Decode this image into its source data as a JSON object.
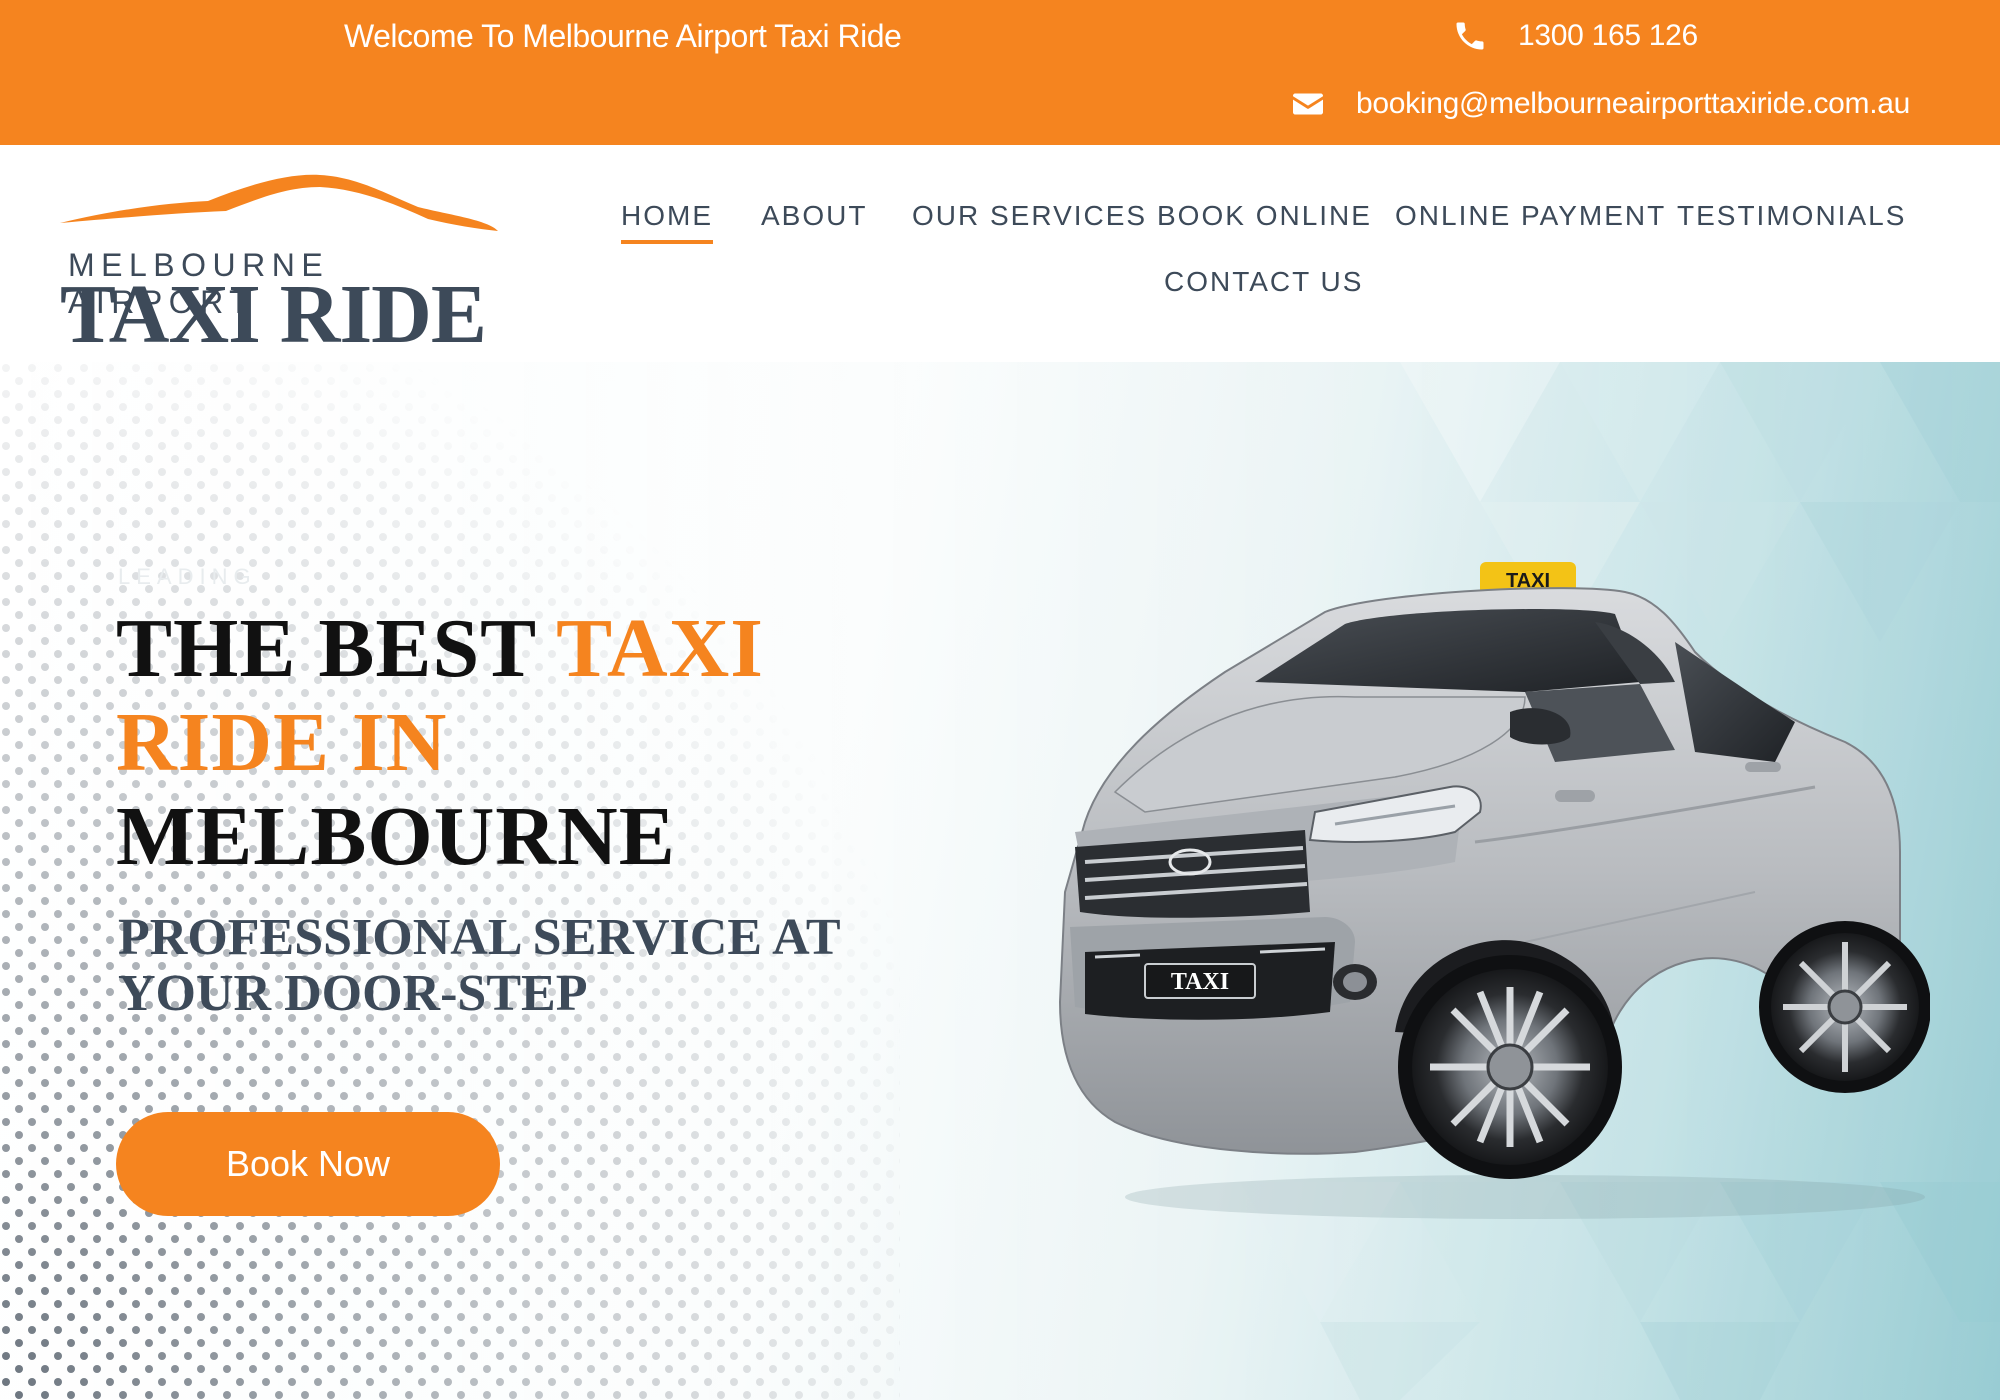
{
  "topbar": {
    "welcome": "Welcome To Melbourne Airport Taxi Ride",
    "phone": "1300 165 126",
    "email": "booking@melbourneairporttaxiride.com.au",
    "background_color": "#f5841f",
    "phone_icon": "phone-icon",
    "email_icon": "envelope-icon"
  },
  "logo": {
    "line1": "MELBOURNE AIRPORT",
    "line2": "TAXI RIDE",
    "swoosh_color": "#f5841f",
    "text_color": "#3d4a59"
  },
  "nav": {
    "items": [
      {
        "label": "HOME",
        "active": true
      },
      {
        "label": "ABOUT",
        "active": false
      },
      {
        "label": "OUR SERVICES",
        "active": false
      },
      {
        "label": "BOOK ONLINE",
        "active": false
      },
      {
        "label": "ONLINE PAYMENT",
        "active": false
      },
      {
        "label": "TESTIMONIALS",
        "active": false
      },
      {
        "label": "CONTACT US",
        "active": false
      }
    ]
  },
  "hero": {
    "eyebrow": "LEADING",
    "headline": {
      "part1": "THE BEST ",
      "accent": "TAXI RIDE IN",
      "part3": "MELBOURNE"
    },
    "subline": "PROFESSIONAL SERVICE AT YOUR DOOR-STEP",
    "cta_label": "Book Now",
    "car_roof_sign": "TAXI",
    "car_plate": "TAXI",
    "accent_color": "#f5841f"
  }
}
